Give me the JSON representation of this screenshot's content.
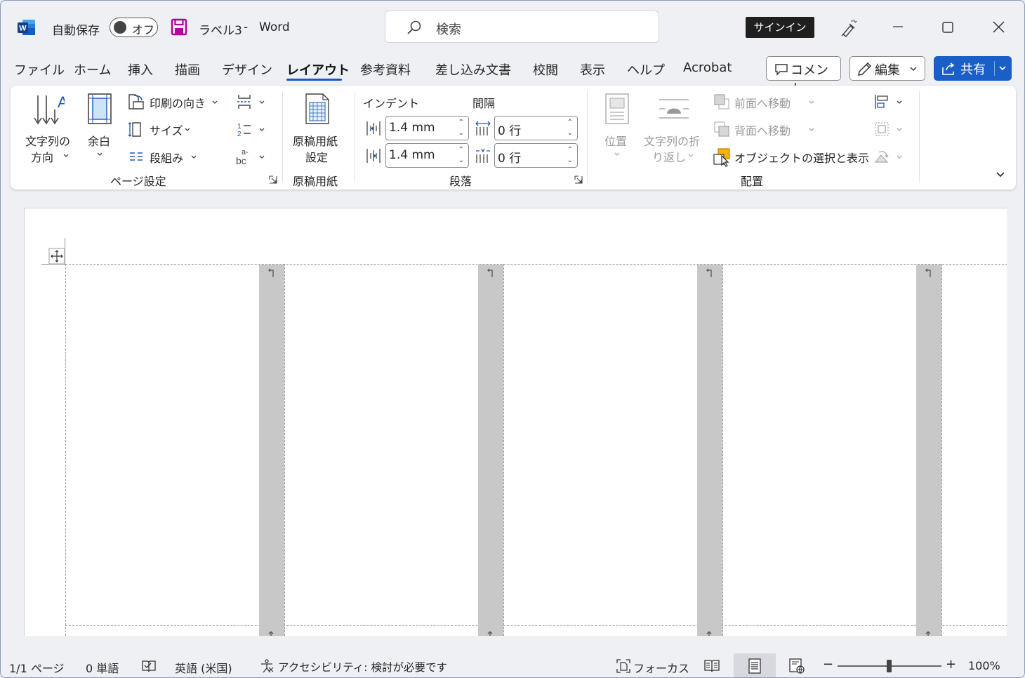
{
  "titlebar": {
    "autosave_label": "自動保存",
    "autosave_state": "オフ",
    "doc_title": "ラベル3",
    "separator": "-",
    "app_name": "Word",
    "search_placeholder": "検索",
    "signin": "サインイン"
  },
  "tabs": [
    "ファイル",
    "ホーム",
    "挿入",
    "描画",
    "デザイン",
    "レイアウト",
    "参考資料",
    "差し込み文書",
    "校閲",
    "表示",
    "ヘルプ",
    "Acrobat"
  ],
  "active_tab": "レイアウト",
  "actions": {
    "comment": "コメント",
    "edit": "編集",
    "share": "共有"
  },
  "ribbon": {
    "page_setup": {
      "text_direction_1": "文字列の",
      "text_direction_2": "方向",
      "margins": "余白",
      "orientation": "印刷の向き",
      "size": "サイズ",
      "columns": "段組み",
      "group_label": "ページ設定"
    },
    "genko": {
      "settings_1": "原稿用紙",
      "settings_2": "設定",
      "group_label": "原稿用紙"
    },
    "paragraph": {
      "indent_label": "インデント",
      "spacing_label": "間隔",
      "indent_left": "1.4 mm",
      "indent_right": "1.4 mm",
      "spacing_before": "0 行",
      "spacing_after": "0 行",
      "group_label": "段落"
    },
    "arrange": {
      "position": "位置",
      "wrap_1": "文字列の折",
      "wrap_2": "り返し",
      "bring_forward": "前面へ移動",
      "send_backward": "背面へ移動",
      "selection_pane": "オブジェクトの選択と表示",
      "group_label": "配置"
    }
  },
  "status": {
    "page": "1/1 ページ",
    "words": "0 単語",
    "language": "英語 (米国)",
    "accessibility": "アクセシビリティ: 検討が必要です",
    "focus": "フォーカス",
    "zoom_minus": "−",
    "zoom_plus": "+",
    "zoom": "100%"
  },
  "colors": {
    "accent": "#185abd",
    "share_bg": "#1a5ec7",
    "gutter": "#c8c8c8",
    "save_icon": "#b4009e"
  }
}
